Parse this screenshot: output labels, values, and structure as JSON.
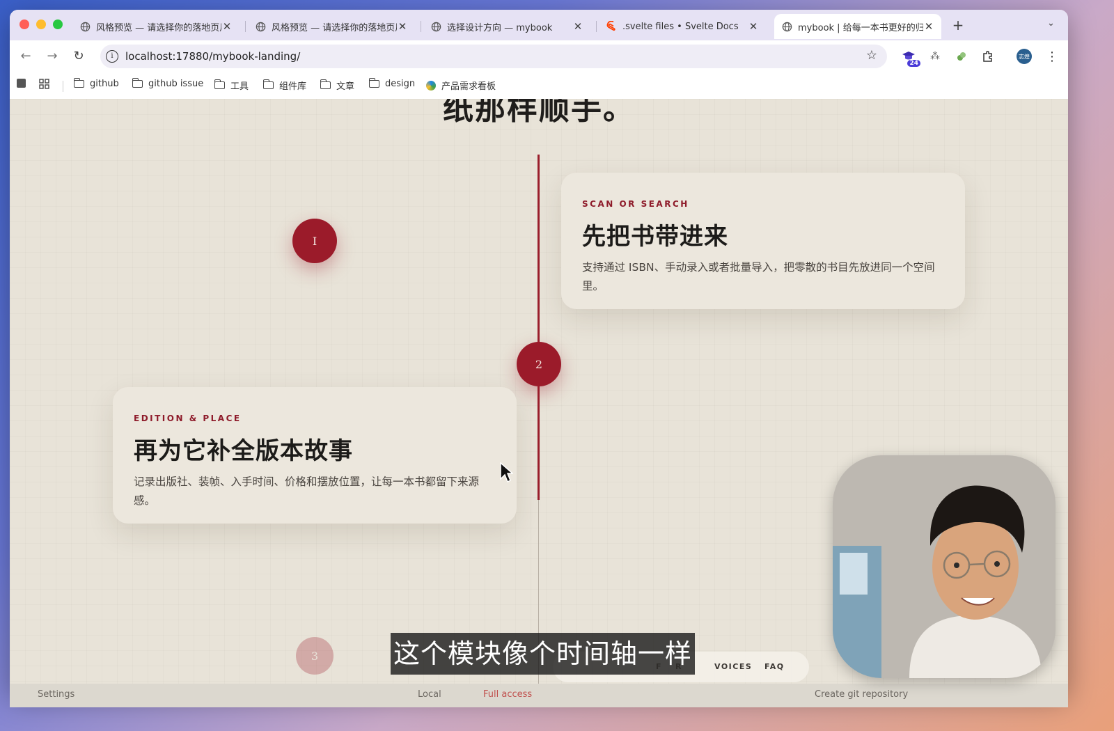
{
  "browser": {
    "tabs": [
      {
        "label": "风格预览 — 请选择你的落地页风格",
        "icon": "globe-icon"
      },
      {
        "label": "风格预览 — 请选择你的落地页风格",
        "icon": "globe-icon"
      },
      {
        "label": "选择设计方向 — mybook",
        "icon": "globe-icon"
      },
      {
        "label": ".svelte files • Svelte Docs",
        "icon": "svelte-icon"
      },
      {
        "label": "mybook | 给每一本书更好的归宿",
        "icon": "globe-icon"
      }
    ],
    "url": "localhost:17880/mybook-landing/",
    "profile_label": "志煌",
    "extension_badge": "24"
  },
  "bookmarks": [
    {
      "label": "github",
      "icon": "folder-icon"
    },
    {
      "label": "github issue",
      "icon": "folder-icon"
    },
    {
      "label": "工具",
      "icon": "folder-icon"
    },
    {
      "label": "组件库",
      "icon": "folder-icon"
    },
    {
      "label": "文章",
      "icon": "folder-icon"
    },
    {
      "label": "design",
      "icon": "folder-icon"
    },
    {
      "label": "产品需求看板",
      "icon": "app-icon"
    }
  ],
  "page": {
    "heading_partial": "纸那样顺手。",
    "steps": [
      {
        "number": "I",
        "kicker": "SCAN OR SEARCH",
        "title": "先把书带进来",
        "description": "支持通过 ISBN、手动录入或者批量导入，把零散的书目先放进同一个空间里。"
      },
      {
        "number": "2",
        "kicker": "EDITION & PLACE",
        "title": "再为它补全版本故事",
        "description": "记录出版社、装帧、入手时间、价格和摆放位置，让每一本书都留下来源感。"
      },
      {
        "number": "3"
      }
    ],
    "subnav": [
      "F",
      "R",
      "VOICES",
      "FAQ"
    ]
  },
  "overlay": {
    "caption": "这个模块像个时间轴一样"
  },
  "under_window": {
    "left": "Settings",
    "mid1": "Local",
    "mid2": "Full access",
    "right": "Create git repository"
  },
  "colors": {
    "accent": "#9b1b2a",
    "page_bg": "#e8e3d8",
    "card_bg": "#ece7dd"
  }
}
